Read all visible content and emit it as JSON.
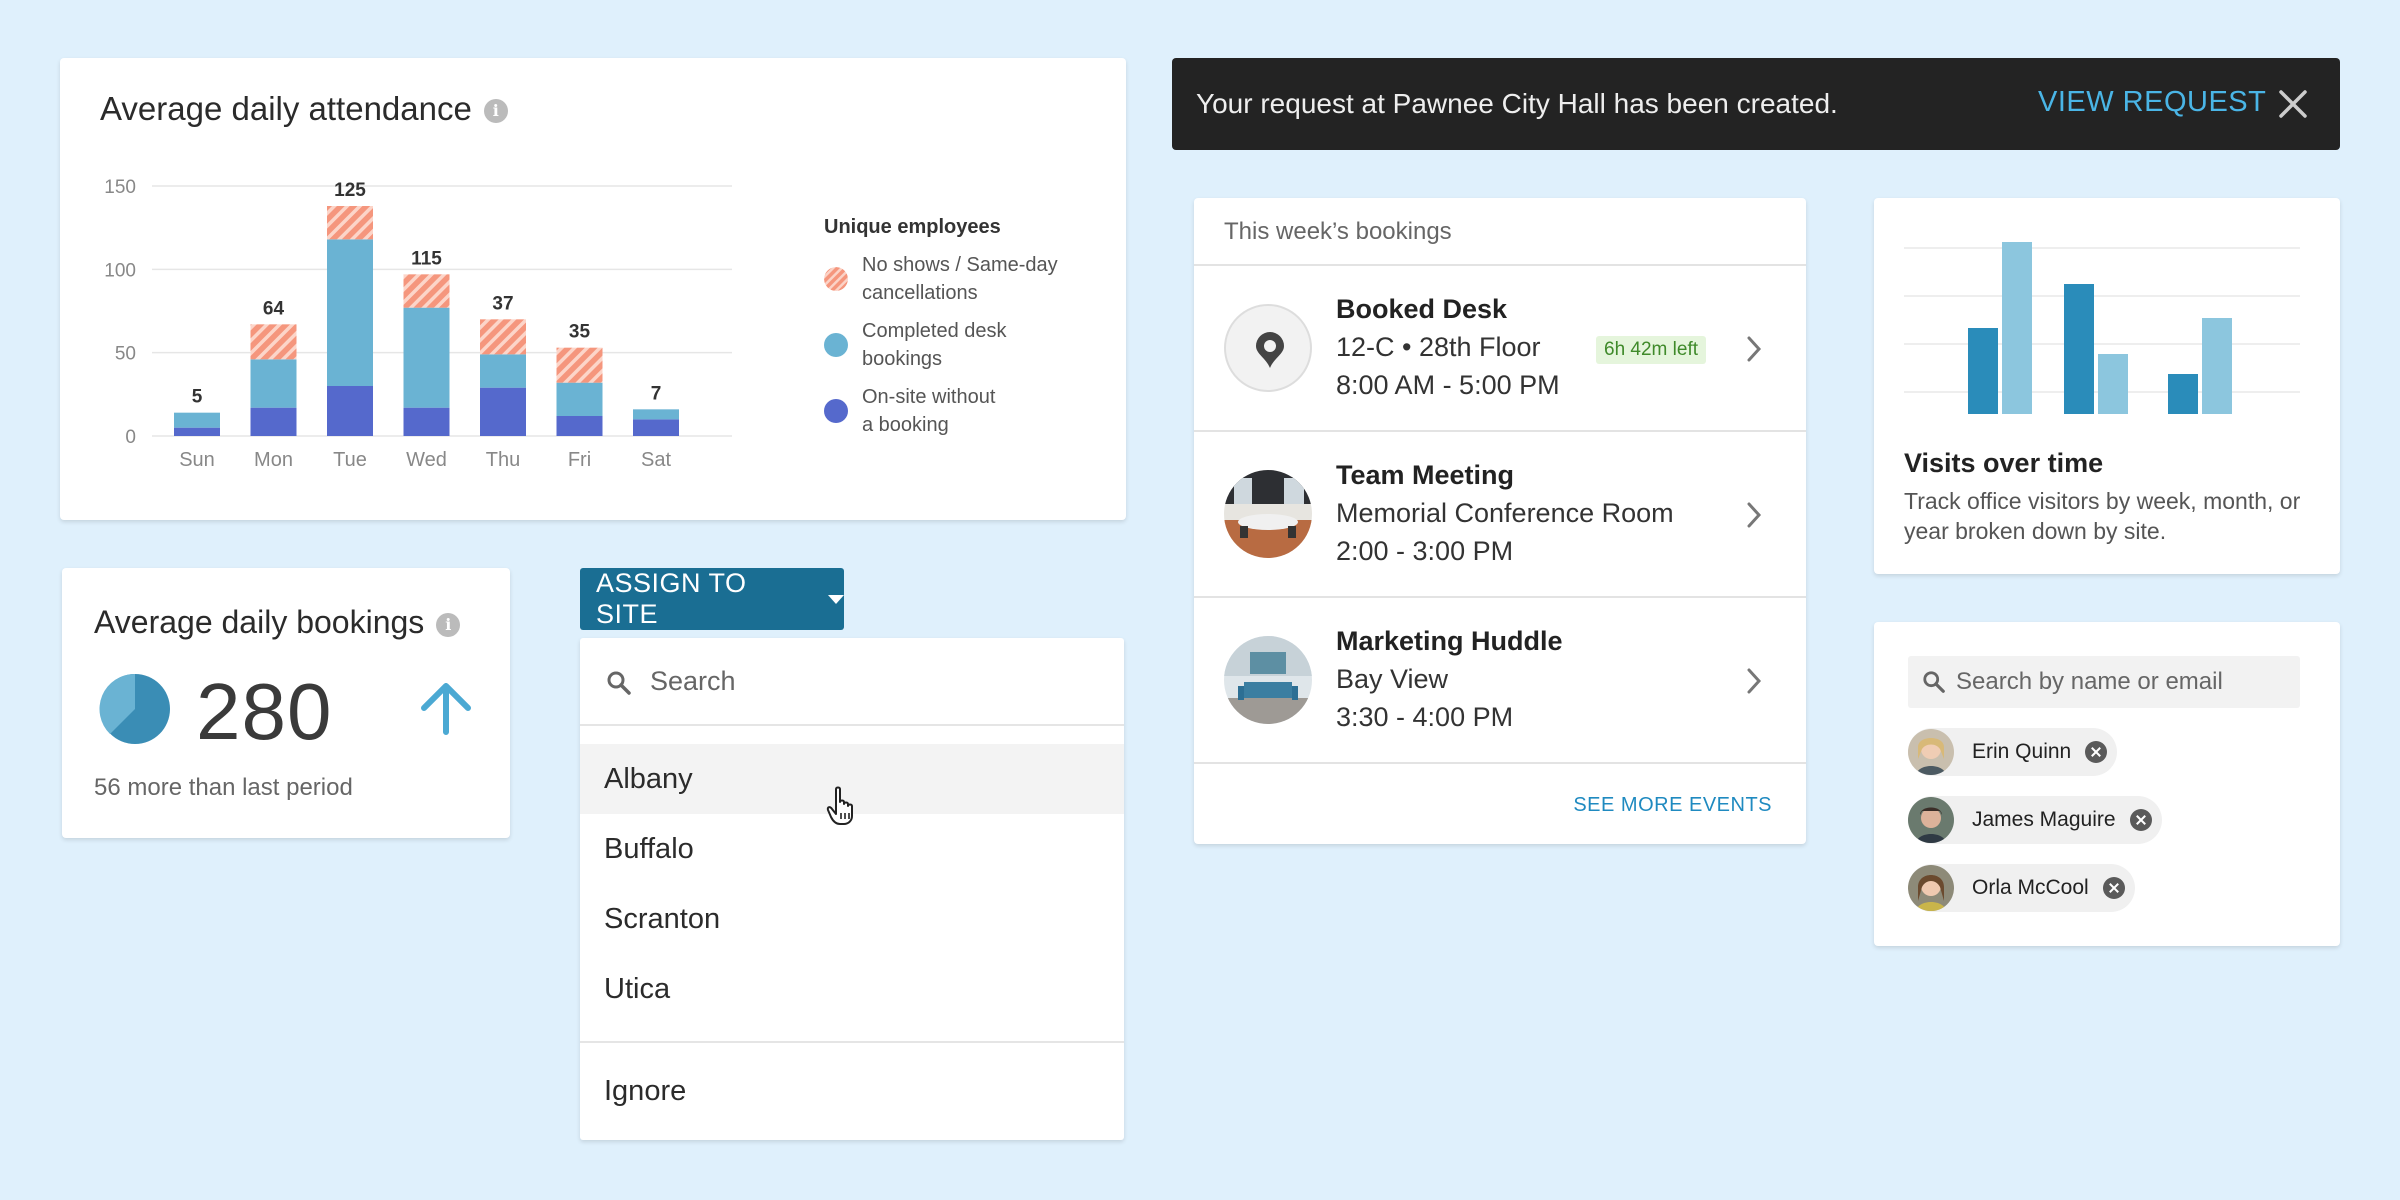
{
  "attendance": {
    "title": "Average daily attendance",
    "legend": {
      "title": "Unique employees",
      "items": [
        {
          "label": "No shows / Same-day cancellations",
          "line1": "No shows / Same-day",
          "line2": "cancellations",
          "color": "#f5967d"
        },
        {
          "label": "Completed desk bookings",
          "line1": "Completed desk",
          "line2": "bookings",
          "color": "#6ab3d3"
        },
        {
          "label": "On-site without a booking",
          "line1": "On-site without",
          "line2": "a booking",
          "color": "#5569cc"
        }
      ]
    }
  },
  "chart_data": {
    "type": "bar",
    "stacked": true,
    "title": "Average daily attendance",
    "categories": [
      "Sun",
      "Mon",
      "Tue",
      "Wed",
      "Thu",
      "Fri",
      "Sat"
    ],
    "ylim": [
      0,
      150
    ],
    "yticks": [
      0,
      50,
      100,
      150
    ],
    "grid": true,
    "legend_position": "right",
    "totals": [
      5,
      64,
      125,
      115,
      37,
      35,
      7
    ],
    "series": [
      {
        "name": "On-site without a booking",
        "values": [
          5,
          17,
          30,
          17,
          29,
          12,
          10
        ]
      },
      {
        "name": "Completed desk bookings",
        "values": [
          9,
          29,
          88,
          60,
          20,
          20,
          6
        ]
      },
      {
        "name": "No shows / Same-day cancellations",
        "values": [
          0,
          21,
          20,
          20,
          21,
          21,
          0
        ]
      }
    ]
  },
  "bookings": {
    "title": "Average daily bookings",
    "value": "280",
    "subtext": "56 more than last period"
  },
  "assign": {
    "button_label": "ASSIGN TO SITE",
    "search_placeholder": "Search",
    "items": [
      "Albany",
      "Buffalo",
      "Scranton",
      "Utica"
    ],
    "ignore": "Ignore"
  },
  "toast": {
    "message": "Your request at Pawnee City Hall has been created.",
    "action": "VIEW REQUEST"
  },
  "week": {
    "title": "This week’s bookings",
    "events": [
      {
        "title": "Booked Desk",
        "line2": "12-C • 28th Floor",
        "line3": "8:00 AM - 5:00 PM",
        "badge": "6h 42m left"
      },
      {
        "title": "Team Meeting",
        "line2": "Memorial Conference Room",
        "line3": "2:00 - 3:00 PM"
      },
      {
        "title": "Marketing Huddle",
        "line2": "Bay View",
        "line3": "3:30 - 4:00 PM"
      }
    ],
    "more": "SEE MORE EVENTS"
  },
  "visits": {
    "title": "Visits over time",
    "description": "Track office visitors by week, month, or year broken down by site."
  },
  "people": {
    "search_placeholder": "Search by name or email",
    "chips": [
      "Erin Quinn",
      "James Maguire",
      "Orla McCool"
    ]
  }
}
